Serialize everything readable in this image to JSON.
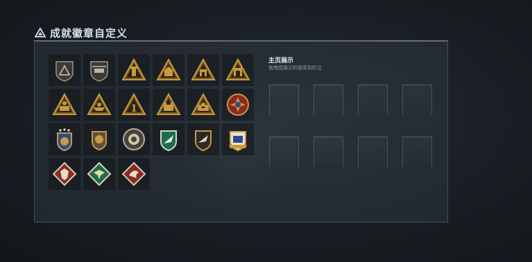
{
  "header": {
    "title": "成就徽章自定义",
    "icon": "triangle-warning-icon"
  },
  "home_display": {
    "title": "主页展示",
    "hint": "拖拽想展示的徽章到栏位",
    "slot_count": 8
  },
  "badges": [
    {
      "icon": "shield-triangle-badge-icon"
    },
    {
      "icon": "shield-helicopter-badge-icon"
    },
    {
      "icon": "triangle-tower-badge-icon"
    },
    {
      "icon": "triangle-building-badge-icon"
    },
    {
      "icon": "triangle-house-badge-icon"
    },
    {
      "icon": "triangle-gate-badge-icon"
    },
    {
      "icon": "triangle-scene-badge-icon"
    },
    {
      "icon": "triangle-boat-badge-icon"
    },
    {
      "icon": "triangle-number-one-badge-icon"
    },
    {
      "icon": "triangle-fortress-badge-icon"
    },
    {
      "icon": "triangle-crowd-badge-icon"
    },
    {
      "icon": "cross-medal-badge-icon"
    },
    {
      "icon": "stars-shield-badge-icon"
    },
    {
      "icon": "lion-shield-badge-icon"
    },
    {
      "icon": "round-emblem-badge-icon"
    },
    {
      "icon": "green-eagle-shield-badge-icon"
    },
    {
      "icon": "eagle-shield-badge-icon"
    },
    {
      "icon": "coat-of-arms-badge-icon"
    },
    {
      "icon": "red-diamond-wolf-badge-icon"
    },
    {
      "icon": "green-diamond-eagle-badge-icon"
    },
    {
      "icon": "red-diamond-dragon-badge-icon"
    }
  ],
  "colors": {
    "gold": "#c99a3e",
    "dark_gold": "#7a5a22",
    "red": "#8a2a22",
    "green": "#1f6b4a",
    "title_text": "#d7dee6"
  }
}
